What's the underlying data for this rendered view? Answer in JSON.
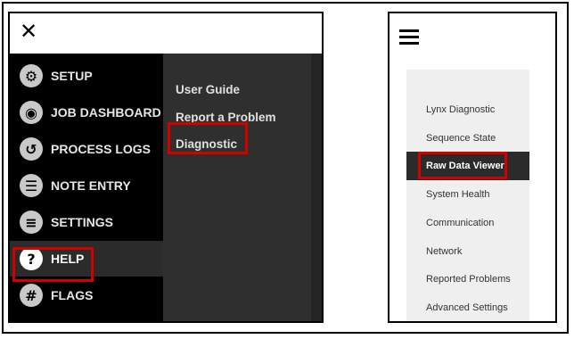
{
  "left_panel": {
    "nav": [
      {
        "label": "SETUP",
        "icon": "gear-icon"
      },
      {
        "label": "JOB DASHBOARD",
        "icon": "eye-icon"
      },
      {
        "label": "PROCESS LOGS",
        "icon": "history-icon"
      },
      {
        "label": "NOTE ENTRY",
        "icon": "clipboard-icon"
      },
      {
        "label": "SETTINGS",
        "icon": "sliders-icon"
      },
      {
        "label": "HELP",
        "icon": "question-icon",
        "active": true
      },
      {
        "label": "FLAGS",
        "icon": "hash-icon"
      }
    ],
    "help_submenu": [
      "User Guide",
      "Report a Problem",
      "Diagnostic"
    ]
  },
  "right_panel": {
    "diagnostic_menu": [
      "Lynx Diagnostic",
      "Sequence State",
      "Raw Data Viewer",
      "System Health",
      "Communication",
      "Network",
      "Reported Problems",
      "Advanced Settings"
    ],
    "active_item": "Raw Data Viewer"
  },
  "colors": {
    "highlight": "#d40000",
    "nav_bg": "#000000",
    "submenu_bg": "#2f2f2f",
    "right_menu_bg": "#efefef"
  }
}
